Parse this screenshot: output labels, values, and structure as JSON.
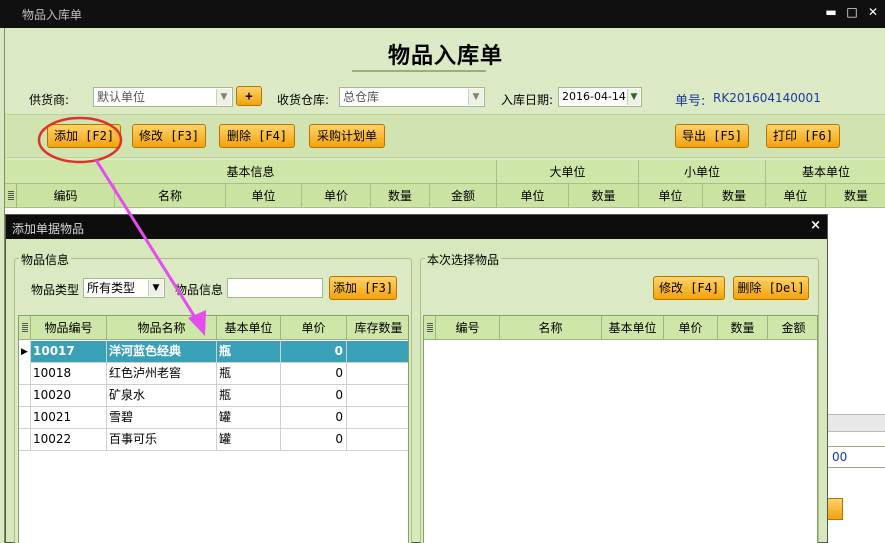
{
  "window": {
    "title": "物品入库单",
    "min_glyph": "▬",
    "max_glyph": "□",
    "close_glyph": "✕"
  },
  "form": {
    "title": "物品入库单",
    "supplier_label": "供货商:",
    "supplier_value": "默认单位",
    "supplier_add": "+",
    "warehouse_label": "收货仓库:",
    "warehouse_value": "总仓库",
    "date_label": "入库日期:",
    "date_value": "2016-04-14",
    "docno_label": "单号:",
    "docno_value": "RK201604140001"
  },
  "toolbar": {
    "add": "添加 [F2]",
    "edit": "修改 [F3]",
    "delete": "删除 [F4]",
    "plan": "采购计划单",
    "export": "导出 [F5]",
    "print": "打印 [F6]"
  },
  "main_grid": {
    "groups": [
      "基本信息",
      "大单位",
      "小单位",
      "基本单位"
    ],
    "columns": [
      "编码",
      "名称",
      "单位",
      "单价",
      "数量",
      "金额",
      "单位",
      "数量",
      "单位",
      "数量",
      "单位",
      "数量"
    ]
  },
  "side_value": "00",
  "dialog": {
    "title": "添加单据物品",
    "close": "×",
    "left_group": "物品信息",
    "type_label": "物品类型",
    "type_value": "所有类型",
    "info_label": "物品信息",
    "info_value": "",
    "add_btn": "添加 [F3]",
    "left_columns": [
      "物品编号",
      "物品名称",
      "基本单位",
      "单价",
      "库存数量"
    ],
    "rows": [
      {
        "code": "10017",
        "name": "洋河蓝色经典",
        "unit": "瓶",
        "price": "0",
        "stock": ""
      },
      {
        "code": "10018",
        "name": "红色泸州老窖",
        "unit": "瓶",
        "price": "0",
        "stock": ""
      },
      {
        "code": "10020",
        "name": "矿泉水",
        "unit": "瓶",
        "price": "0",
        "stock": ""
      },
      {
        "code": "10021",
        "name": "雪碧",
        "unit": "罐",
        "price": "0",
        "stock": ""
      },
      {
        "code": "10022",
        "name": "百事可乐",
        "unit": "罐",
        "price": "0",
        "stock": ""
      }
    ],
    "right_group": "本次选择物品",
    "edit_btn": "修改 [F4]",
    "del_btn": "删除 [Del]",
    "right_columns": [
      "编号",
      "名称",
      "基本单位",
      "单价",
      "数量",
      "金额"
    ]
  },
  "colors": {
    "accent_green": "#d9e9c2",
    "button_orange": "#f3a20c",
    "selection": "#3aa0b8",
    "annotation_red": "#e0302a",
    "annotation_arrow": "#e44cf0"
  }
}
